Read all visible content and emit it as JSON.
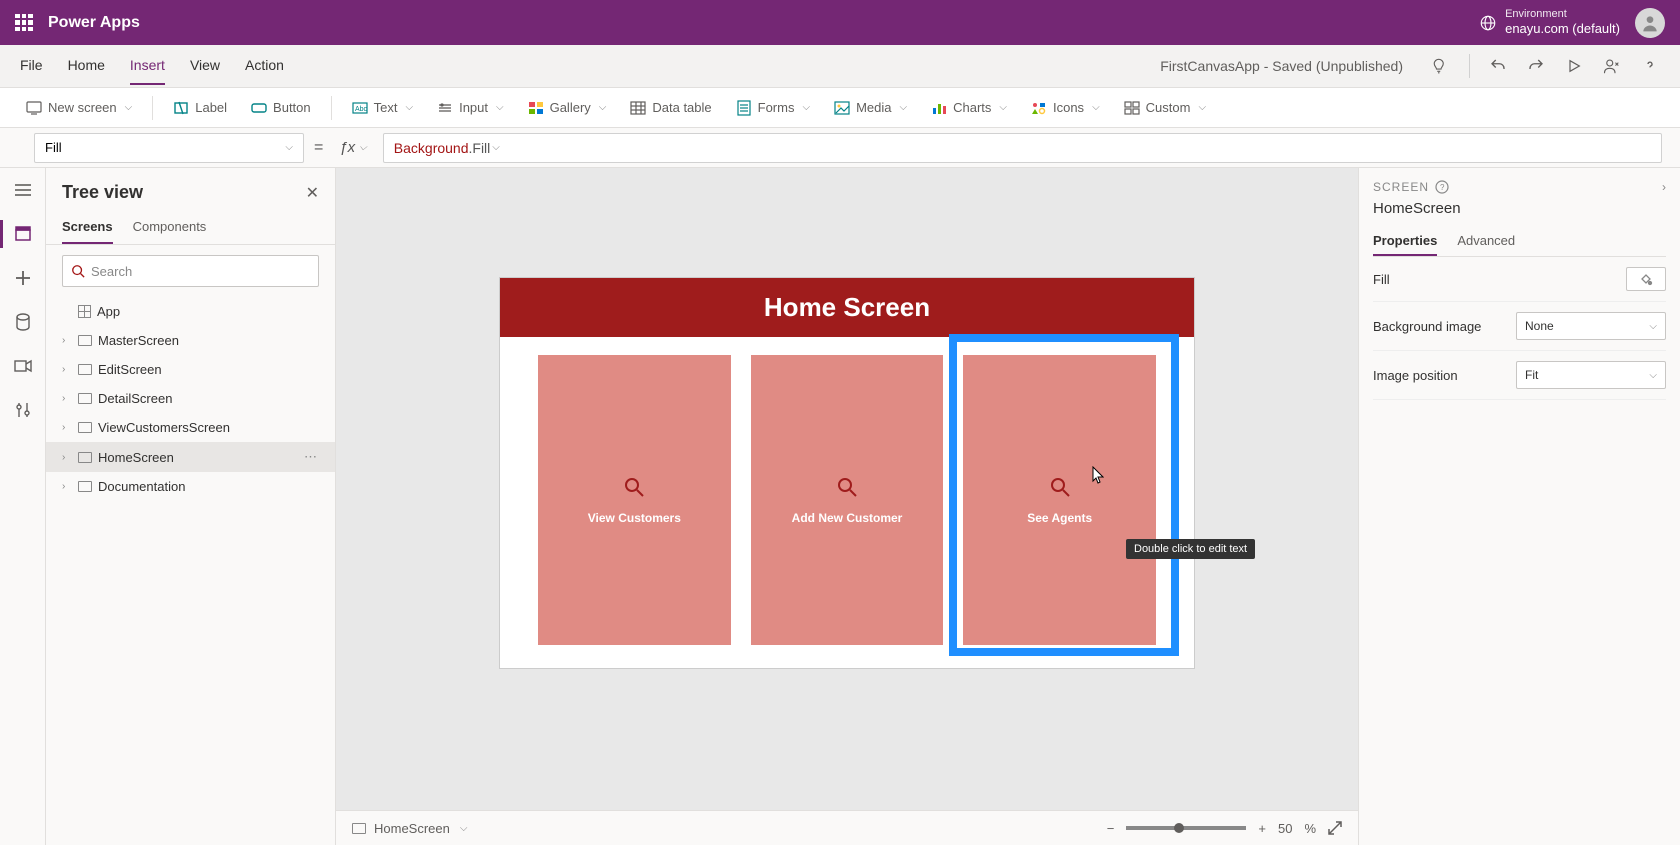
{
  "header": {
    "brand": "Power Apps",
    "environment_label": "Environment",
    "environment_name": "enayu.com (default)"
  },
  "menubar": {
    "items": [
      "File",
      "Home",
      "Insert",
      "View",
      "Action"
    ],
    "active_index": 2,
    "app_status": "FirstCanvasApp - Saved (Unpublished)"
  },
  "ribbon": {
    "new_screen": "New screen",
    "label": "Label",
    "button": "Button",
    "text": "Text",
    "input": "Input",
    "gallery": "Gallery",
    "data_table": "Data table",
    "forms": "Forms",
    "media": "Media",
    "charts": "Charts",
    "icons": "Icons",
    "custom": "Custom"
  },
  "formula": {
    "property": "Fill",
    "expr_obj": "Background",
    "expr_prop": ".Fill"
  },
  "tree": {
    "title": "Tree view",
    "tabs": [
      "Screens",
      "Components"
    ],
    "active_tab": 0,
    "search_placeholder": "Search",
    "app_item": "App",
    "items": [
      {
        "label": "MasterScreen"
      },
      {
        "label": "EditScreen"
      },
      {
        "label": "DetailScreen"
      },
      {
        "label": "ViewCustomersScreen"
      },
      {
        "label": "HomeScreen",
        "selected": true
      },
      {
        "label": "Documentation"
      }
    ]
  },
  "canvas": {
    "screen_title": "Home Screen",
    "tiles": [
      {
        "label": "View Customers"
      },
      {
        "label": "Add New Customer"
      },
      {
        "label": "See Agents"
      }
    ],
    "tooltip": "Double click to edit text"
  },
  "status": {
    "screen_name": "HomeScreen",
    "zoom_value": "50",
    "zoom_pct": "%"
  },
  "props": {
    "type": "SCREEN",
    "name": "HomeScreen",
    "tabs": [
      "Properties",
      "Advanced"
    ],
    "active_tab": 0,
    "fill_label": "Fill",
    "bg_image_label": "Background image",
    "bg_image_value": "None",
    "img_pos_label": "Image position",
    "img_pos_value": "Fit"
  }
}
